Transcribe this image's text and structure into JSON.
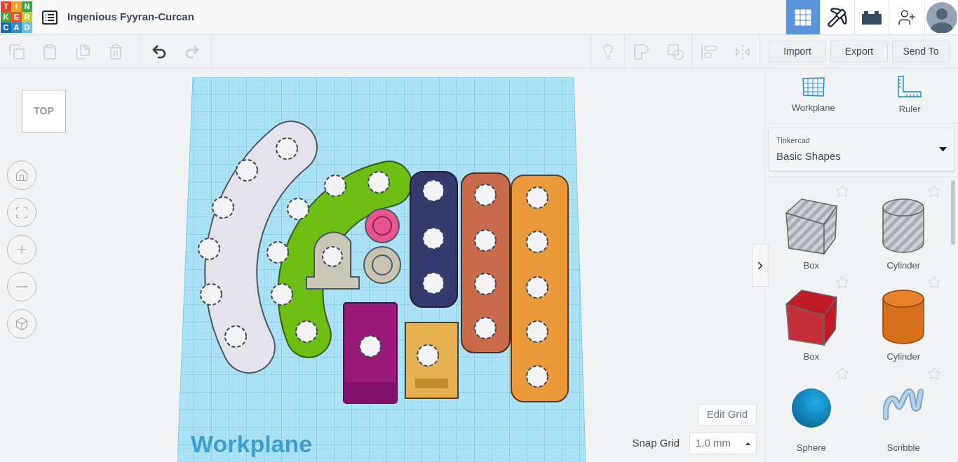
{
  "header": {
    "logo_letters": [
      "T",
      "I",
      "N",
      "K",
      "E",
      "R",
      "C",
      "A",
      "D"
    ],
    "title": "Ingenious Fyyran-Curcan",
    "views": [
      {
        "kind": "grid",
        "selected": true
      },
      {
        "kind": "pickaxe",
        "selected": false
      },
      {
        "kind": "bricks",
        "selected": false
      }
    ]
  },
  "toolbar": {
    "tools": [
      {
        "kind": "copy",
        "disabled": true
      },
      {
        "kind": "paste",
        "disabled": true
      },
      {
        "kind": "duplicate",
        "disabled": true
      },
      {
        "kind": "delete",
        "disabled": true
      },
      {
        "kind": "undo",
        "disabled": false
      },
      {
        "kind": "redo",
        "disabled": true
      }
    ],
    "shape_tools": [
      {
        "kind": "note",
        "disabled": true
      },
      {
        "kind": "group",
        "disabled": true
      },
      {
        "kind": "ungroup",
        "disabled": true
      },
      {
        "kind": "align",
        "disabled": true
      },
      {
        "kind": "mirror",
        "disabled": true
      }
    ],
    "actions": [
      "Import",
      "Export",
      "Send To"
    ]
  },
  "canvas": {
    "view_cube": "TOP",
    "nav": [
      {
        "kind": "home"
      },
      {
        "kind": "fit"
      },
      {
        "kind": "zoom-in"
      },
      {
        "kind": "zoom-out"
      },
      {
        "kind": "perspective"
      }
    ],
    "workplane_label": "Workplane",
    "edit_grid": "Edit Grid",
    "snap_grid": {
      "label": "Snap Grid",
      "value": "1.0 mm"
    }
  },
  "panel": {
    "tools": [
      {
        "kind": "workplane",
        "label": "Workplane"
      },
      {
        "kind": "ruler",
        "label": "Ruler"
      }
    ],
    "library": {
      "label": "Tinkercad",
      "value": "Basic Shapes"
    },
    "shapes": [
      {
        "kind": "box",
        "label": "Box",
        "hole": true
      },
      {
        "kind": "cylinder",
        "label": "Cylinder",
        "hole": true
      },
      {
        "kind": "box",
        "label": "Box",
        "hole": false
      },
      {
        "kind": "cylinder",
        "label": "Cylinder",
        "hole": false
      },
      {
        "kind": "sphere",
        "label": "Sphere"
      },
      {
        "kind": "scribble",
        "label": "Scribble"
      }
    ]
  }
}
